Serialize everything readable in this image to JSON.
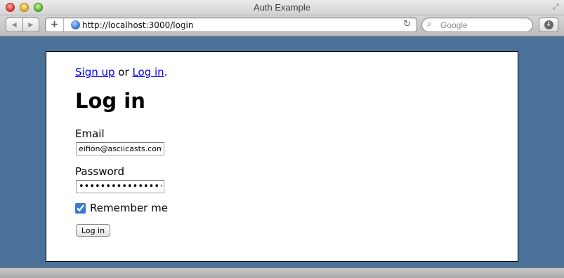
{
  "window": {
    "title": "Auth Example",
    "url": "http://localhost:3000/login",
    "search_placeholder": "Google",
    "icons": {
      "back": "back-arrow-icon",
      "forward": "forward-arrow-icon",
      "add_bookmark": "plus-icon",
      "site": "globe-icon",
      "reload": "reload-icon",
      "search": "magnifier-icon",
      "downloads": "download-icon",
      "fullscreen": "resize-arrows-icon"
    }
  },
  "page": {
    "nav": {
      "signup_link": "Sign up",
      "separator": "or",
      "login_link": "Log in",
      "period": "."
    },
    "title": "Log in",
    "form": {
      "email_label": "Email",
      "email_value": "eifion@asciicasts.com",
      "password_label": "Password",
      "password_value": "••••••••••••••••",
      "remember_label": "Remember me",
      "remember_checked": true,
      "submit_label": "Log in"
    }
  },
  "colors": {
    "background": "#4a7298",
    "link": "#0000ee",
    "panel": "#ffffff"
  }
}
